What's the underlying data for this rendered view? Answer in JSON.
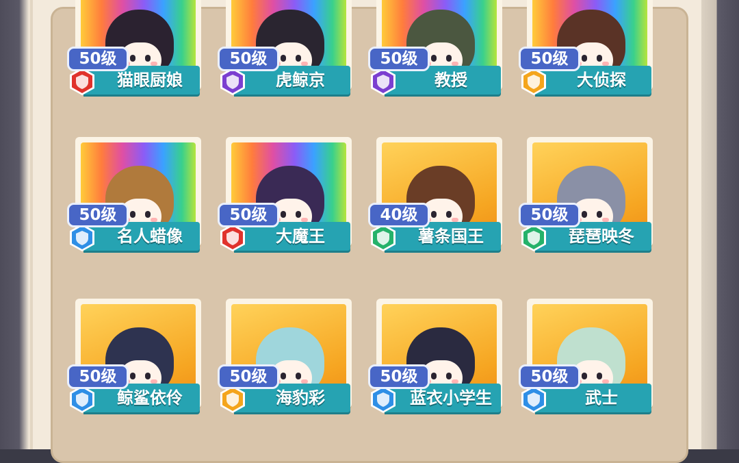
{
  "cards": [
    {
      "level": "50级",
      "name": "猫眼厨娘",
      "bg": "rainbow",
      "badge": "#e0322c",
      "hair": "#2b2230"
    },
    {
      "level": "50级",
      "name": "虎鲸京",
      "bg": "rainbow",
      "badge": "#7b3fd0",
      "hair": "#2a2530"
    },
    {
      "level": "50级",
      "name": "教授",
      "bg": "rainbow",
      "badge": "#7b3fd0",
      "hair": "#4b5740"
    },
    {
      "level": "50级",
      "name": "大侦探",
      "bg": "rainbow",
      "badge": "#f4a51c",
      "hair": "#5a3326"
    },
    {
      "level": "50级",
      "name": "名人蜡像",
      "bg": "rainbow",
      "badge": "#2f8fe6",
      "hair": "#b07a3c"
    },
    {
      "level": "50级",
      "name": "大魔王",
      "bg": "rainbow",
      "badge": "#e0322c",
      "hair": "#3a2a55"
    },
    {
      "level": "40级",
      "name": "薯条国王",
      "bg": "gold",
      "badge": "#25b26a",
      "hair": "#6a3d26"
    },
    {
      "level": "50级",
      "name": "琵琶映冬",
      "bg": "gold",
      "badge": "#25b26a",
      "hair": "#8a90a6"
    },
    {
      "level": "50级",
      "name": "鲸鲨依伶",
      "bg": "gold",
      "badge": "#2f8fe6",
      "hair": "#2e3350"
    },
    {
      "level": "50级",
      "name": "海豹彩",
      "bg": "gold",
      "badge": "#f4a51c",
      "hair": "#9fd6dc"
    },
    {
      "level": "50级",
      "name": "蓝衣小学生",
      "bg": "gold",
      "badge": "#2f8fe6",
      "hair": "#2a2a40"
    },
    {
      "level": "50级",
      "name": "武士",
      "bg": "gold",
      "badge": "#2f8fe6",
      "hair": "#bfe0cf"
    }
  ]
}
